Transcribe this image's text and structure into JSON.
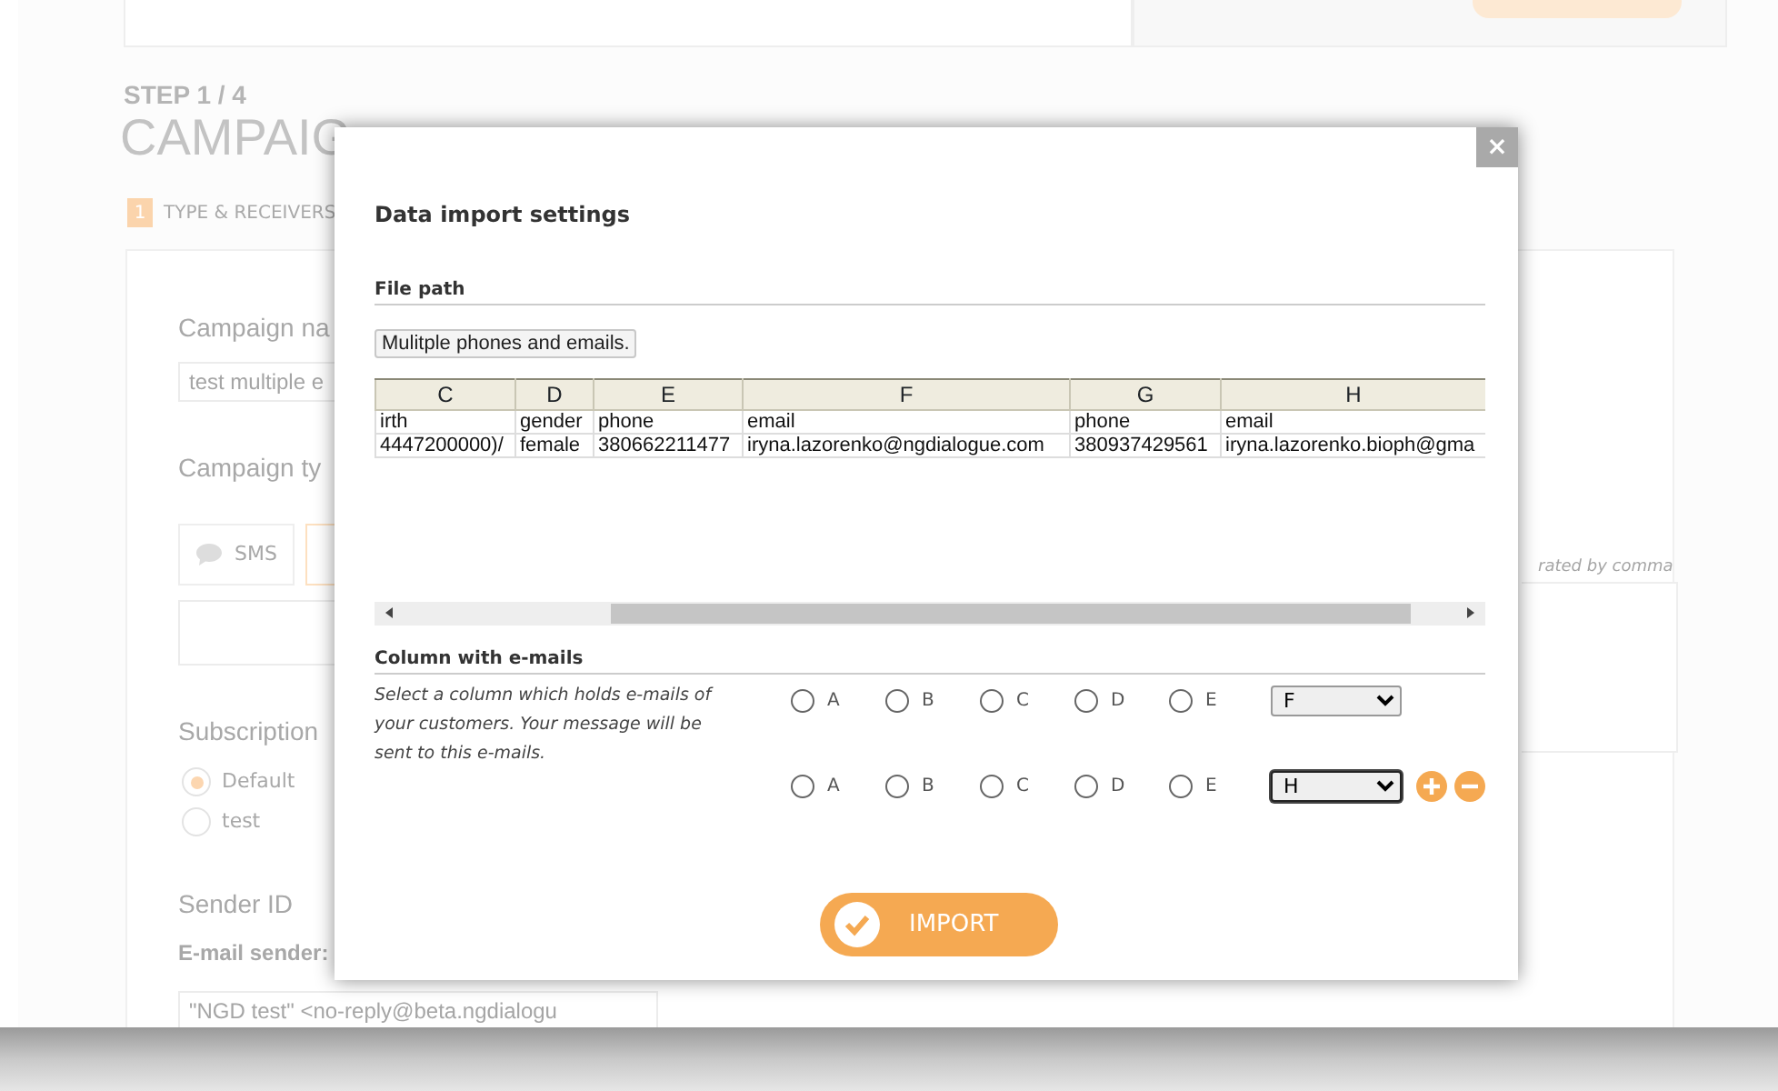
{
  "page": {
    "step": "STEP 1 / 4",
    "title": "CAMPAIG",
    "steps": [
      {
        "number": "1",
        "label": "TYPE & RECEIVERS",
        "selected": true
      }
    ],
    "campaign_name": {
      "label": "Campaign na",
      "value": "test multiple e"
    },
    "campaign_type": {
      "label": "Campaign ty",
      "options": [
        {
          "label": "SMS",
          "selected": false
        },
        {
          "selected": true
        }
      ]
    },
    "subscription": {
      "label": "Subscription",
      "options": [
        {
          "label": "Default",
          "selected": true
        },
        {
          "label": "test",
          "selected": false
        }
      ]
    },
    "sender": {
      "label": "Sender ID",
      "field_label": "E-mail sender:",
      "value": "\"NGD test\" <no-reply@beta.ngdialogu"
    },
    "receivers_hint": "rated by comma"
  },
  "dialog": {
    "title": "Data import settings",
    "close": "×",
    "file_path": {
      "label": "File path",
      "file": "Mulitple phones and emails."
    },
    "table": {
      "columns": [
        "C",
        "D",
        "E",
        "F",
        "G",
        "H"
      ],
      "rows": [
        [
          "irth",
          "gender",
          "phone",
          "email",
          "phone",
          "email"
        ],
        [
          "4447200000)/",
          "female",
          "380662211477",
          "iryna.lazorenko@ngdialogue.com",
          "380937429561",
          "iryna.lazorenko.bioph@gma"
        ]
      ]
    },
    "email_columns": {
      "label": "Column with e-mails",
      "description": "Select a column which holds e-mails of your customers. Your message will be sent to this e-mails.",
      "rows": [
        {
          "options": [
            {
              "label": "A",
              "checked": false
            },
            {
              "label": "B",
              "checked": false
            },
            {
              "label": "C",
              "checked": false
            },
            {
              "label": "D",
              "checked": false
            },
            {
              "label": "E",
              "checked": false
            }
          ],
          "select": "F",
          "focused": false,
          "add_remove": false
        },
        {
          "options": [
            {
              "label": "A",
              "checked": false
            },
            {
              "label": "B",
              "checked": false
            },
            {
              "label": "C",
              "checked": false
            },
            {
              "label": "D",
              "checked": false
            },
            {
              "label": "E",
              "checked": false
            }
          ],
          "select": "H",
          "focused": true,
          "add_remove": true
        }
      ]
    },
    "import_button": "IMPORT"
  }
}
